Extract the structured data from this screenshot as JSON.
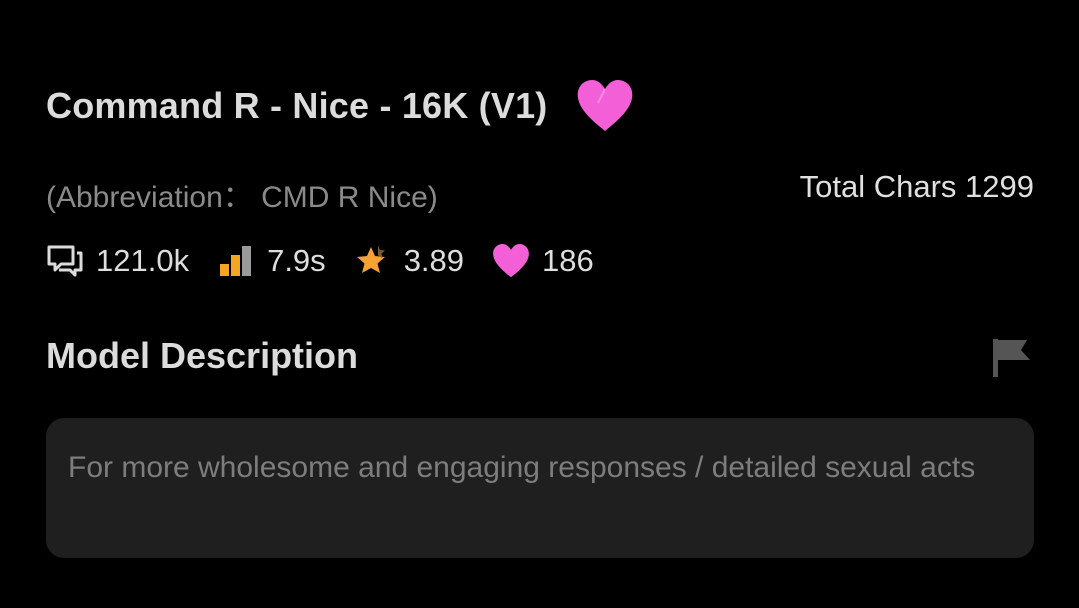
{
  "model": {
    "title": "Command R - Nice - 16K (V1)",
    "abbreviation": "(Abbreviation： CMD R Nice)",
    "total_chars": "Total Chars 1299",
    "favorite_icon": "heart-icon"
  },
  "stats": {
    "chats": "121.0k",
    "chats_icon": "chat-bubbles-icon",
    "response_time": "7.9s",
    "response_time_icon": "signal-bars-icon",
    "rating": "3.89",
    "rating_icon": "star-icon",
    "likes": "186",
    "likes_icon": "heart-icon"
  },
  "description": {
    "heading": "Model Description",
    "text": "For more wholesome and engaging responses / detailed sexual acts",
    "report_icon": "flag-icon"
  },
  "colors": {
    "background": "#000000",
    "heart_pink": "#f25fd6",
    "signal_orange": "#f4a623",
    "star_orange": "#f4a233",
    "text_primary": "#dcdcdc",
    "text_muted": "#8a8a8a",
    "box_bg": "#1f1f1f"
  }
}
